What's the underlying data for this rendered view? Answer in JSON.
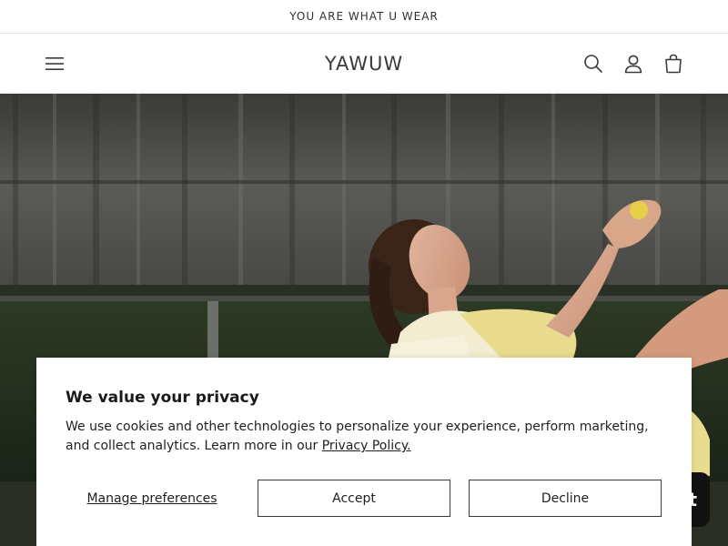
{
  "announcement": {
    "text": "YOU ARE WHAT U WEAR"
  },
  "header": {
    "logo": "YAWUW",
    "icons": {
      "menu": "hamburger-menu-icon",
      "search": "search-icon",
      "account": "user-icon",
      "cart": "shopping-bag-icon"
    }
  },
  "hero": {
    "image": "woman-reclining-in-yellow-knit-outfit"
  },
  "cookie_banner": {
    "title": "We value your privacy",
    "body": "We use cookies and other technologies to personalize your experience, perform marketing, and collect analytics. Learn more in our",
    "policy_link": "Privacy Policy.",
    "manage_label": "Manage preferences",
    "accept_label": "Accept",
    "decline_label": "Decline"
  },
  "chat": {
    "partial_label": "t"
  },
  "colors": {
    "text": "#121212",
    "border": "#e6e6e6",
    "button_border": "#3a3a3a",
    "outfit_yellow": "#e9dc8e"
  }
}
